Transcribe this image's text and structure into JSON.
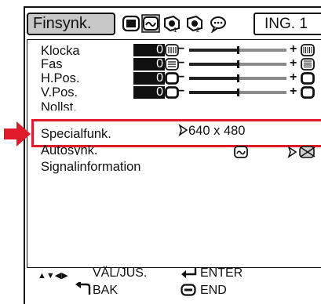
{
  "header": {
    "tab_label": "Finsynk.",
    "input_label": "ING. 1",
    "tab_icons": [
      "picture-tab-icon",
      "fine-sync-tab-icon",
      "setup-1-tab-icon",
      "setup-2-tab-icon",
      "language-tab-icon"
    ]
  },
  "rows": [
    {
      "label": "Klocka",
      "value": "0",
      "icon": "clock-pattern-icon"
    },
    {
      "label": "Fas",
      "value": "0",
      "icon": "phase-pattern-icon"
    },
    {
      "label": "H.Pos.",
      "value": "0",
      "icon": "horizontal-position-icon"
    },
    {
      "label": "V.Pos.",
      "value": "0",
      "icon": "vertical-position-icon"
    },
    {
      "label": "Nollst."
    },
    {
      "label": "Specialfunk.",
      "option": "640 x 480"
    },
    {
      "label": "Autosynk."
    },
    {
      "label": "Signalinformation"
    }
  ],
  "footer": {
    "select_adjust": "VÄL/JUS.",
    "enter": "ENTER",
    "back": "BAK",
    "end": "END"
  },
  "colors": {
    "highlight": "#e0192b",
    "tab_bg": "#c8c8c8",
    "bar": "#8a8a8a"
  }
}
